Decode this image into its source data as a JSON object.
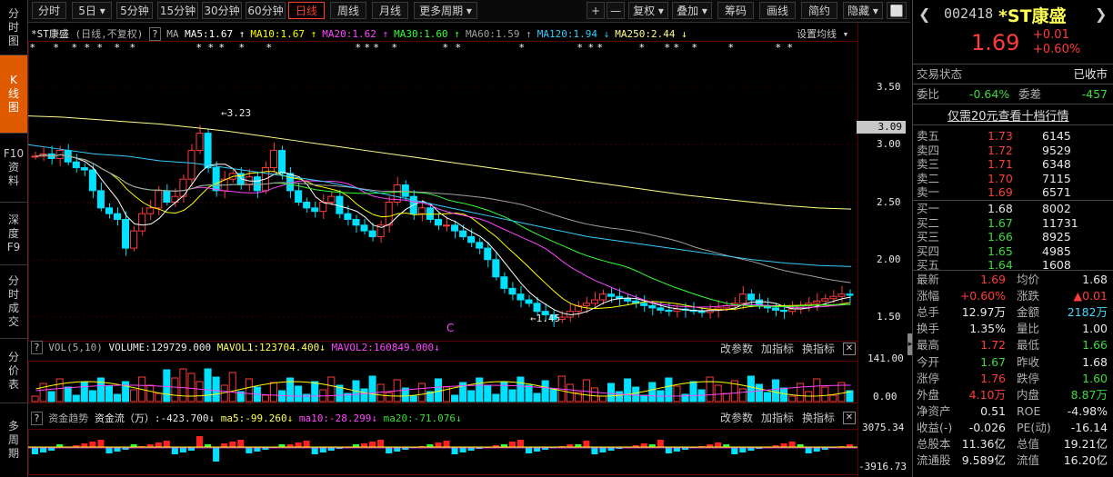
{
  "left_nav": [
    {
      "label": "分\n时\n图"
    },
    {
      "label": "K\n线\n图"
    },
    {
      "label": "F10\n资\n料"
    },
    {
      "label": "深\n度\nF9"
    },
    {
      "label": "分\n时\n成\n交"
    },
    {
      "label": "分\n价\n表"
    },
    {
      "label": "多\n周\n期"
    }
  ],
  "toolbar": {
    "periods": [
      "分时",
      "5日",
      "5分钟",
      "15分钟",
      "30分钟",
      "60分钟",
      "日线",
      "周线",
      "月线",
      "更多周期"
    ],
    "active_period": "日线",
    "plus": "+",
    "minus": "—",
    "restore": "复权",
    "overlay": "叠加",
    "chips": "筹码",
    "draw": "画线",
    "simple": "简约",
    "hide": "隐藏"
  },
  "main_chart": {
    "title": "*ST康盛",
    "subtitle": "(日线,不复权)",
    "help": "?",
    "ma_prefix": "MA",
    "ma": [
      {
        "label": "MA5:1.67",
        "arrow": "↑",
        "color": "#ffffff"
      },
      {
        "label": "MA10:1.67",
        "arrow": "↑",
        "color": "#ffff00"
      },
      {
        "label": "MA20:1.62",
        "arrow": "↑",
        "color": "#ff44ff"
      },
      {
        "label": "MA30:1.60",
        "arrow": "↑",
        "color": "#33ff33"
      },
      {
        "label": "MA60:1.59",
        "arrow": "↑",
        "color": "#a0a0a0"
      },
      {
        "label": "MA120:1.94",
        "arrow": "↓",
        "color": "#33ccff"
      },
      {
        "label": "MA250:2.44",
        "arrow": "↓",
        "color": "#ffff88"
      }
    ],
    "settings": "设置均线",
    "high_label": "3.23",
    "low_label": "1.45",
    "current_price_tag": "3.09",
    "y_ticks": [
      "3.50",
      "3.00",
      "2.50",
      "2.00",
      "1.50"
    ]
  },
  "volume_panel": {
    "label": "VOL(5,10)",
    "volume": "VOLUME:129729.000",
    "mavol1": "MAVOL1:123704.400",
    "mavol2": "MAVOL2:160849.000",
    "arrow1": "↓",
    "arrow2": "↓",
    "modify": "改参数",
    "add": "加指标",
    "switch": "换指标",
    "y_top": "141.00",
    "y_bottom": "0.00"
  },
  "fund_panel": {
    "label": "资金趋势",
    "flow": "资金流（万）:-423.700",
    "ma5": "ma5:-99.260",
    "ma10": "ma10:-28.299",
    "ma20": "ma20:-71.076",
    "arrow": "↓",
    "modify": "改参数",
    "add": "加指标",
    "switch": "换指标",
    "y_top": "3075.34",
    "y_bottom": "-3916.73"
  },
  "quote": {
    "code": "002418",
    "name": "*ST康盛",
    "price": "1.69",
    "change": "+0.01",
    "change_pct": "+0.60%",
    "status_label": "交易状态",
    "status_value": "已收市",
    "weibi_label": "委比",
    "weibi_value": "-0.64%",
    "weicha_label": "委差",
    "weicha_value": "-457",
    "promo": "仅需20元查看十档行情",
    "asks": [
      {
        "label": "卖五",
        "price": "1.73",
        "vol": "6145"
      },
      {
        "label": "卖四",
        "price": "1.72",
        "vol": "9529"
      },
      {
        "label": "卖三",
        "price": "1.71",
        "vol": "6348"
      },
      {
        "label": "卖二",
        "price": "1.70",
        "vol": "7115"
      },
      {
        "label": "卖一",
        "price": "1.69",
        "vol": "6571"
      }
    ],
    "bids": [
      {
        "label": "买一",
        "price": "1.68",
        "vol": "8002"
      },
      {
        "label": "买二",
        "price": "1.67",
        "vol": "11731"
      },
      {
        "label": "买三",
        "price": "1.66",
        "vol": "8925"
      },
      {
        "label": "买四",
        "price": "1.65",
        "vol": "4985"
      },
      {
        "label": "买五",
        "price": "1.64",
        "vol": "1608"
      }
    ],
    "stats": [
      {
        "l1": "最新",
        "v1": "1.69",
        "c1": "red",
        "l2": "均价",
        "v2": "1.68",
        "c2": "white"
      },
      {
        "l1": "涨幅",
        "v1": "+0.60%",
        "c1": "red",
        "l2": "涨跌",
        "v2": "▲0.01",
        "c2": "red"
      },
      {
        "l1": "总手",
        "v1": "12.97万",
        "c1": "white",
        "l2": "金额",
        "v2": "2182万",
        "c2": "cyan"
      },
      {
        "l1": "换手",
        "v1": "1.35%",
        "c1": "white",
        "l2": "量比",
        "v2": "1.00",
        "c2": "white"
      },
      {
        "l1": "最高",
        "v1": "1.72",
        "c1": "red",
        "l2": "最低",
        "v2": "1.66",
        "c2": "green"
      },
      {
        "l1": "今开",
        "v1": "1.67",
        "c1": "green",
        "l2": "昨收",
        "v2": "1.68",
        "c2": "white"
      },
      {
        "l1": "涨停",
        "v1": "1.76",
        "c1": "red",
        "l2": "跌停",
        "v2": "1.60",
        "c2": "green"
      },
      {
        "l1": "外盘",
        "v1": "4.10万",
        "c1": "red",
        "l2": "内盘",
        "v2": "8.87万",
        "c2": "green"
      },
      {
        "l1": "净资产",
        "v1": "0.51",
        "c1": "white",
        "l2": "ROE",
        "v2": "-4.98%",
        "c2": "white"
      },
      {
        "l1": "收益(-)",
        "v1": "-0.026",
        "c1": "white",
        "l2": "PE(动)",
        "v2": "-16.14",
        "c2": "white"
      },
      {
        "l1": "总股本",
        "v1": "11.36亿",
        "c1": "white",
        "l2": "总值",
        "v2": "19.21亿",
        "c2": "white"
      },
      {
        "l1": "流通股",
        "v1": "9.589亿",
        "c1": "white",
        "l2": "流值",
        "v2": "16.20亿",
        "c2": "white"
      }
    ]
  },
  "colors": {
    "up": "#ff3b3b",
    "down": "#00e0ff",
    "bg": "#000000",
    "grid": "#3a0000"
  },
  "chart_data": {
    "type": "line",
    "y_ticks": [
      3.5,
      3.0,
      2.5,
      2.0,
      1.5
    ],
    "close": [
      2.9,
      2.92,
      2.88,
      2.95,
      2.85,
      2.8,
      2.78,
      2.6,
      2.45,
      2.4,
      2.35,
      2.1,
      2.25,
      2.4,
      2.45,
      2.6,
      2.5,
      2.55,
      2.7,
      2.95,
      3.1,
      2.8,
      2.6,
      2.7,
      2.75,
      2.65,
      2.72,
      2.6,
      2.8,
      2.95,
      2.75,
      2.6,
      2.5,
      2.45,
      2.42,
      2.5,
      2.55,
      2.4,
      2.35,
      2.3,
      2.25,
      2.2,
      2.3,
      2.5,
      2.65,
      2.55,
      2.4,
      2.45,
      2.35,
      2.3,
      2.3,
      2.25,
      2.2,
      2.15,
      2.1,
      2.0,
      1.85,
      1.75,
      1.7,
      1.65,
      1.62,
      1.55,
      1.52,
      1.48,
      1.5,
      1.55,
      1.6,
      1.62,
      1.65,
      1.7,
      1.68,
      1.66,
      1.64,
      1.62,
      1.6,
      1.58,
      1.56,
      1.55,
      1.57,
      1.56,
      1.55,
      1.54,
      1.56,
      1.58,
      1.6,
      1.62,
      1.7,
      1.65,
      1.6,
      1.58,
      1.56,
      1.55,
      1.57,
      1.6,
      1.62,
      1.64,
      1.66,
      1.68,
      1.7,
      1.69
    ],
    "ma250": [
      3.25,
      3.24,
      3.22,
      3.2,
      3.18,
      3.15,
      3.12,
      3.08,
      3.04,
      3.0,
      2.96,
      2.92,
      2.88,
      2.84,
      2.8,
      2.76,
      2.72,
      2.68,
      2.64,
      2.6,
      2.56,
      2.53,
      2.5,
      2.47,
      2.45,
      2.44
    ],
    "ma120": [
      3.0,
      2.96,
      2.92,
      2.9,
      2.86,
      2.84,
      2.8,
      2.76,
      2.72,
      2.68,
      2.62,
      2.56,
      2.5,
      2.44,
      2.38,
      2.32,
      2.26,
      2.2,
      2.16,
      2.12,
      2.08,
      2.04,
      2.0,
      1.97,
      1.95,
      1.94
    ],
    "volume_max": 141.0,
    "fund_range": [
      -3916.73,
      3075.34
    ]
  }
}
